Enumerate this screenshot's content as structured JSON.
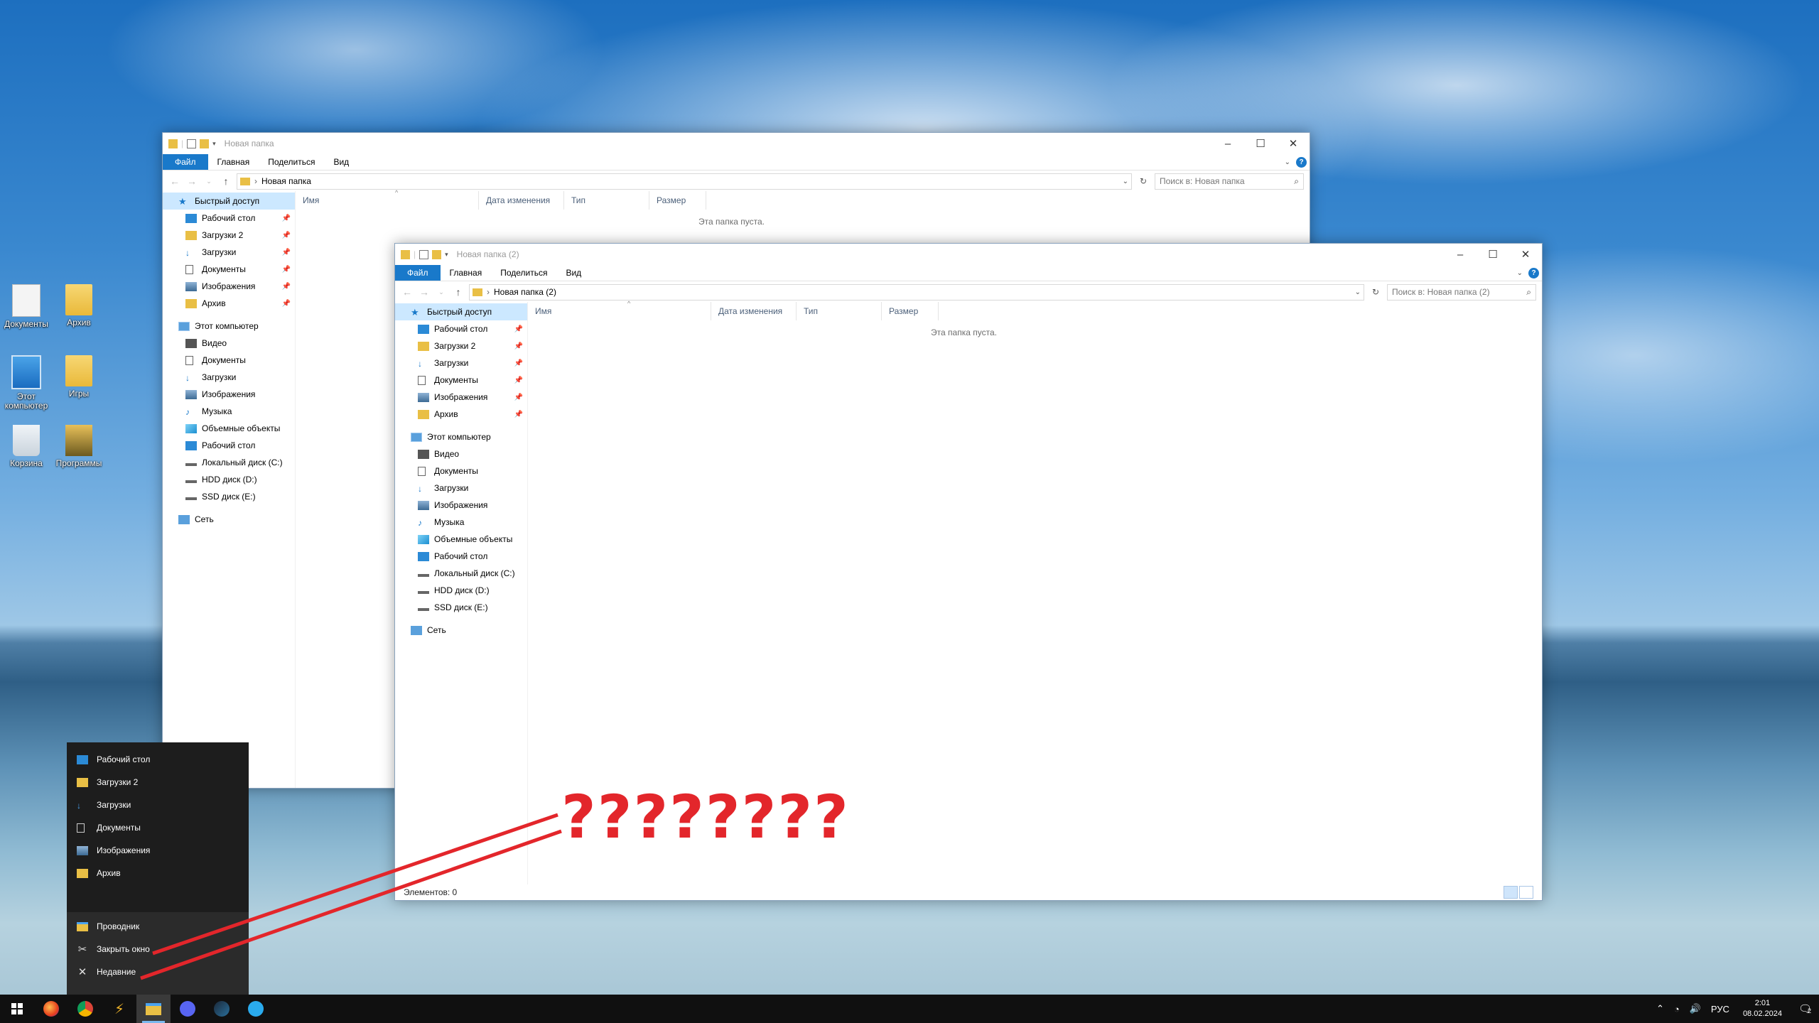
{
  "desktop": {
    "icons": [
      {
        "label": "Документы",
        "type": "doc"
      },
      {
        "label": "Архив",
        "type": "folder"
      },
      {
        "label": "Этот компьютер",
        "type": "pc"
      },
      {
        "label": "Игры",
        "type": "folder"
      },
      {
        "label": "Корзина",
        "type": "bin"
      },
      {
        "label": "Программы",
        "type": "prog"
      }
    ]
  },
  "window1": {
    "title": "Новая папка",
    "tabs": [
      "Файл",
      "Главная",
      "Поделиться",
      "Вид"
    ],
    "address": "Новая папка",
    "search_placeholder": "Поиск в: Новая папка",
    "empty_text": "Эта папка пуста."
  },
  "window2": {
    "title": "Новая папка (2)",
    "tabs": [
      "Файл",
      "Главная",
      "Поделиться",
      "Вид"
    ],
    "address": "Новая папка (2)",
    "search_placeholder": "Поиск в: Новая папка (2)",
    "empty_text": "Эта папка пуста.",
    "status": "Элементов: 0"
  },
  "columns": [
    "Имя",
    "Дата изменения",
    "Тип",
    "Размер"
  ],
  "nav": {
    "quick_access": "Быстрый доступ",
    "quick_items": [
      {
        "label": "Рабочий стол",
        "icon": "desktop-icon"
      },
      {
        "label": "Загрузки 2",
        "icon": "folder-icon"
      },
      {
        "label": "Загрузки",
        "icon": "download-icon"
      },
      {
        "label": "Документы",
        "icon": "document-icon"
      },
      {
        "label": "Изображения",
        "icon": "pictures-icon"
      },
      {
        "label": "Архив",
        "icon": "folder-icon"
      }
    ],
    "this_pc": "Этот компьютер",
    "pc_items": [
      {
        "label": "Видео",
        "icon": "video-icon"
      },
      {
        "label": "Документы",
        "icon": "document-icon"
      },
      {
        "label": "Загрузки",
        "icon": "download-icon"
      },
      {
        "label": "Изображения",
        "icon": "pictures-icon"
      },
      {
        "label": "Музыка",
        "icon": "music-icon"
      },
      {
        "label": "Объемные объекты",
        "icon": "3d-objects-icon"
      },
      {
        "label": "Рабочий стол",
        "icon": "desktop-icon"
      },
      {
        "label": "Локальный диск (C:)",
        "icon": "drive-icon"
      },
      {
        "label": "HDD диск (D:)",
        "icon": "drive-icon"
      },
      {
        "label": "SSD диск (E:)",
        "icon": "drive-icon"
      }
    ],
    "network": "Сеть"
  },
  "jumplist": {
    "pinned": [
      "Рабочий стол",
      "Загрузки 2",
      "Загрузки",
      "Документы",
      "Изображения",
      "Архив"
    ],
    "actions": [
      "Проводник",
      "Закрыть окно",
      "Недавние"
    ]
  },
  "annotation": "????????",
  "tray": {
    "lang": "РУС",
    "time": "2:01",
    "date": "08.02.2024",
    "notif_count": "2"
  },
  "colors": {
    "accent": "#1979ca",
    "annotation": "#e3262b",
    "folder": "#e9bf45"
  }
}
